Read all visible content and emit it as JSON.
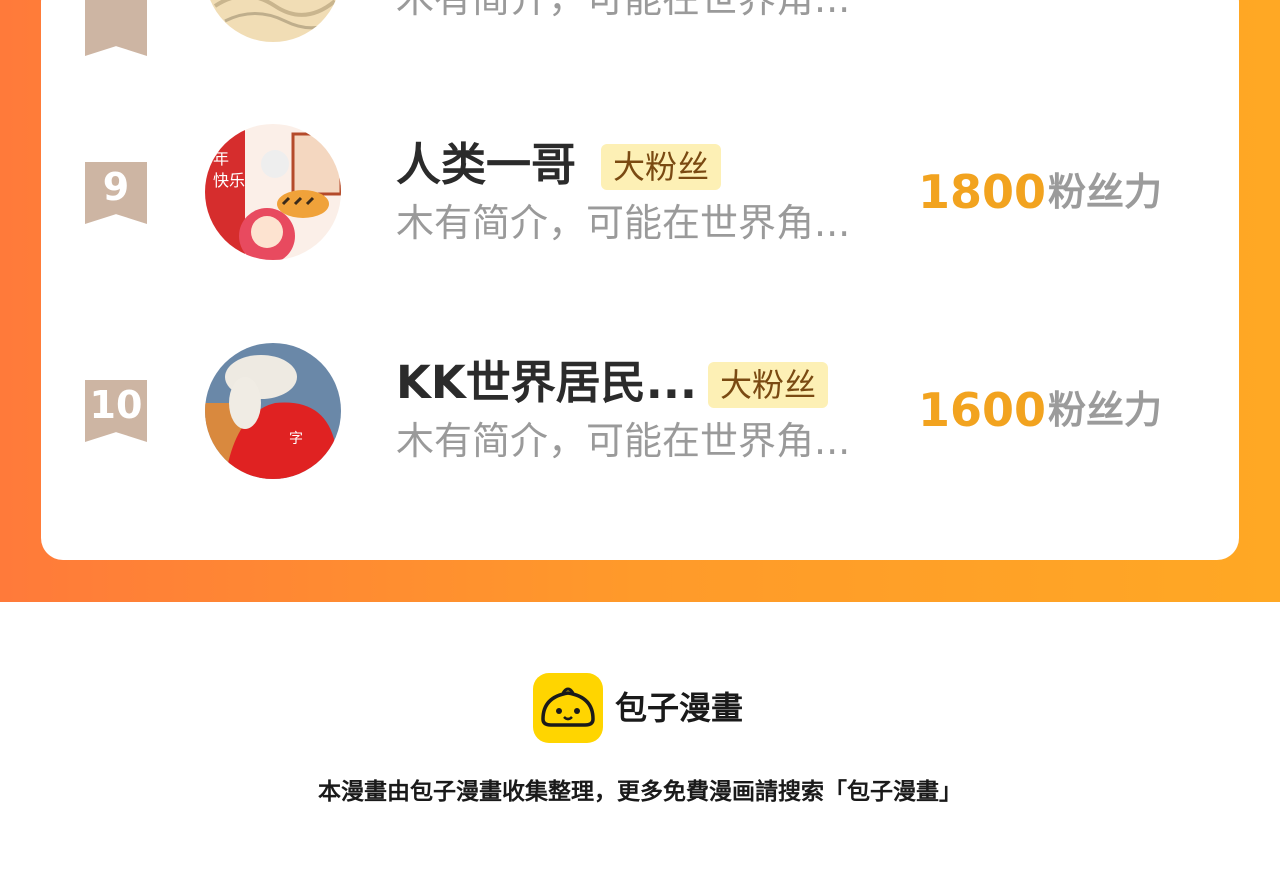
{
  "rows": [
    {
      "rank": "",
      "name": "",
      "badge": "",
      "intro": "木有简介，可能在世界角...",
      "fans": "",
      "fans_unit": ""
    },
    {
      "rank": "9",
      "name": "人类一哥",
      "badge": "大粉丝",
      "intro": "木有简介，可能在世界角...",
      "fans": "1800",
      "fans_unit": "粉丝力"
    },
    {
      "rank": "10",
      "name": "KK世界居民...",
      "badge": "大粉丝",
      "intro": "木有简介，可能在世界角...",
      "fans": "1600",
      "fans_unit": "粉丝力"
    }
  ],
  "brand": {
    "name": "包子漫畫",
    "logo_icon": "baozi-bun-icon",
    "logo_color": "#ffd500"
  },
  "footer": {
    "note": "本漫畫由包子漫畫收集整理，更多免費漫画請搜索「包子漫畫」"
  },
  "colors": {
    "gradient_start": "#ff7a3a",
    "gradient_end": "#ffa824",
    "fans_value": "#f2a31f",
    "badge_bg": "#fdf0b5",
    "rank_bg": "#cdb5a3"
  }
}
